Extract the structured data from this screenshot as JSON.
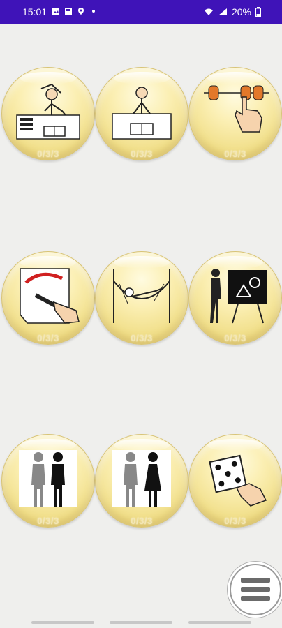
{
  "status_bar": {
    "time": "15:01",
    "battery": "20%",
    "icons_left": [
      "image-icon",
      "gallery-icon",
      "location-icon"
    ],
    "icons_right": [
      "wifi-icon",
      "signal-icon",
      "battery-icon"
    ]
  },
  "activities": [
    {
      "name": "writing-at-desk",
      "score": "0/3/3"
    },
    {
      "name": "reading-at-desk",
      "score": "0/3/3"
    },
    {
      "name": "counting-beads",
      "score": "0/3/3"
    },
    {
      "name": "painting",
      "score": "0/3/3"
    },
    {
      "name": "resting-hammock",
      "score": "0/3/3"
    },
    {
      "name": "teacher-blackboard",
      "score": "0/3/3"
    },
    {
      "name": "two-people",
      "score": "0/3/3"
    },
    {
      "name": "couple",
      "score": "0/3/3"
    },
    {
      "name": "dice",
      "score": "0/3/3"
    }
  ],
  "menu": {
    "icon": "hamburger-menu-icon"
  },
  "colors": {
    "status_bar": "#3f13b8",
    "bubble": "#f1df8a",
    "background": "#efefed"
  }
}
